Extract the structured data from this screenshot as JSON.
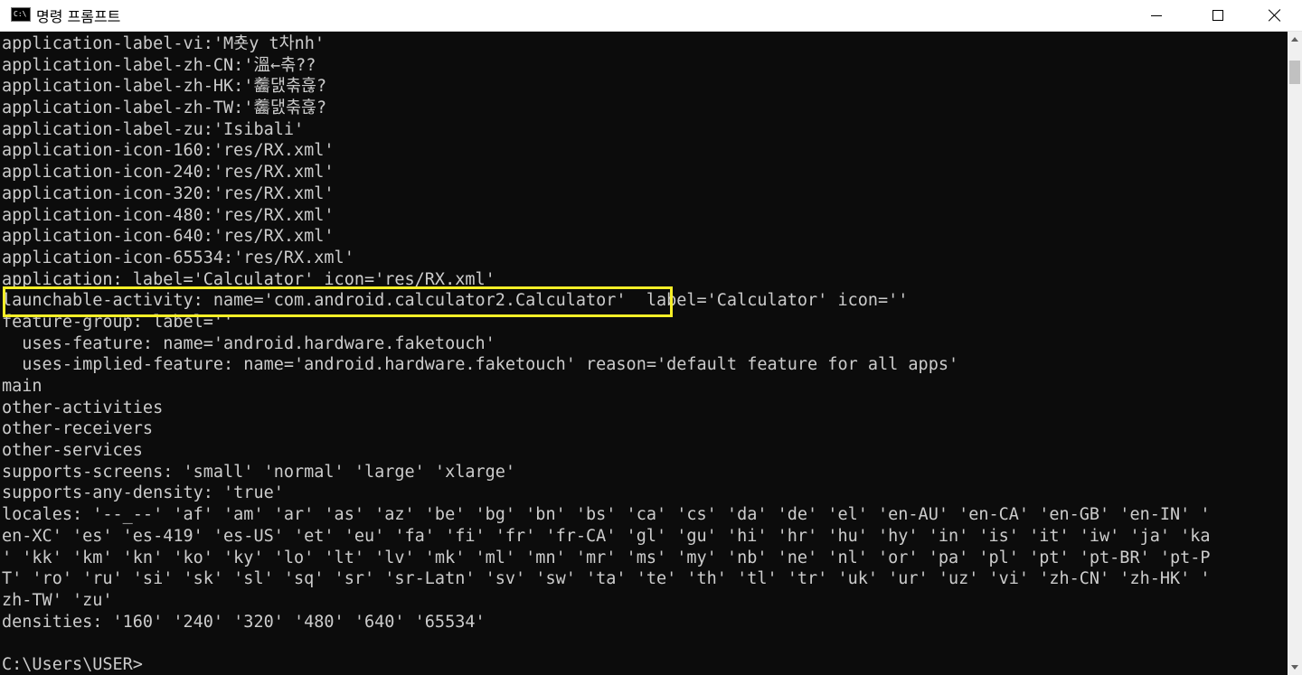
{
  "window": {
    "title": "명령 프롬프트",
    "icon_label": "C:\\",
    "icon": "cmd-icon"
  },
  "controls": {
    "minimize_icon": "minimize-icon",
    "maximize_icon": "maximize-icon",
    "close_icon": "close-icon"
  },
  "console": {
    "lines": [
      "application-label-vi:'M춋y t차nh'",
      "application-label-zh-CN:'溫←춖??",
      "application-label-zh-HK:'齹댌춖흖?",
      "application-label-zh-TW:'齹댌춖흖?",
      "application-label-zu:'Isibali'",
      "application-icon-160:'res/RX.xml'",
      "application-icon-240:'res/RX.xml'",
      "application-icon-320:'res/RX.xml'",
      "application-icon-480:'res/RX.xml'",
      "application-icon-640:'res/RX.xml'",
      "application-icon-65534:'res/RX.xml'",
      "application: label='Calculator' icon='res/RX.xml'",
      "launchable-activity: name='com.android.calculator2.Calculator'  label='Calculator' icon=''",
      "feature-group: label=''",
      "  uses-feature: name='android.hardware.faketouch'",
      "  uses-implied-feature: name='android.hardware.faketouch' reason='default feature for all apps'",
      "main",
      "other-activities",
      "other-receivers",
      "other-services",
      "supports-screens: 'small' 'normal' 'large' 'xlarge'",
      "supports-any-density: 'true'",
      "locales: '--_--' 'af' 'am' 'ar' 'as' 'az' 'be' 'bg' 'bn' 'bs' 'ca' 'cs' 'da' 'de' 'el' 'en-AU' 'en-CA' 'en-GB' 'en-IN' '",
      "en-XC' 'es' 'es-419' 'es-US' 'et' 'eu' 'fa' 'fi' 'fr' 'fr-CA' 'gl' 'gu' 'hi' 'hr' 'hu' 'hy' 'in' 'is' 'it' 'iw' 'ja' 'ka",
      "' 'kk' 'km' 'kn' 'ko' 'ky' 'lo' 'lt' 'lv' 'mk' 'ml' 'mn' 'mr' 'ms' 'my' 'nb' 'ne' 'nl' 'or' 'pa' 'pl' 'pt' 'pt-BR' 'pt-P",
      "T' 'ro' 'ru' 'si' 'sk' 'sl' 'sq' 'sr' 'sr-Latn' 'sv' 'sw' 'ta' 'te' 'th' 'tl' 'tr' 'uk' 'ur' 'uz' 'vi' 'zh-CN' 'zh-HK' '",
      "zh-TW' 'zu'",
      "densities: '160' '240' '320' '480' '640' '65534'",
      "",
      "C:\\Users\\USER>"
    ],
    "highlight_color": "#f7ef27",
    "text_color": "#cccccc",
    "background_color": "#0c0c0c"
  }
}
